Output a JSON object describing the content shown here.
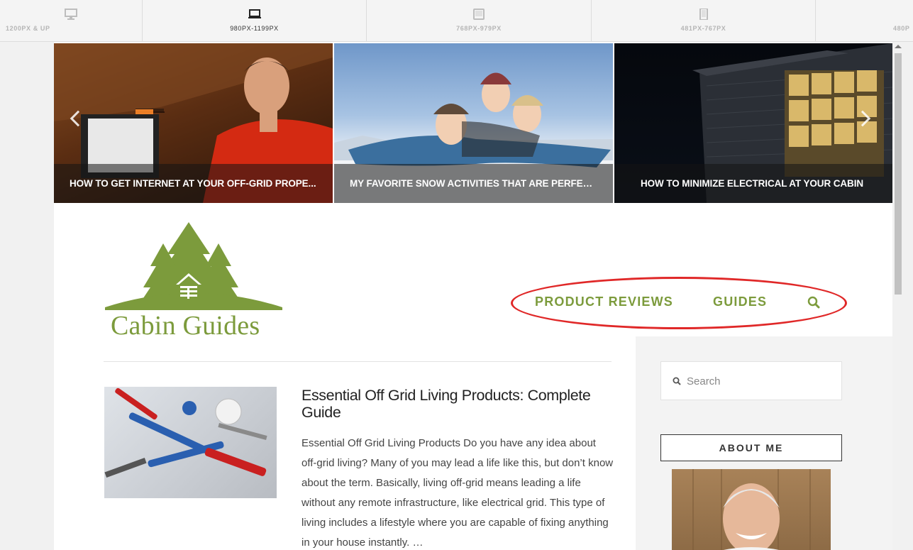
{
  "responsive_bar": {
    "tabs": [
      {
        "label": "1200PX & UP",
        "icon": "desktop-icon"
      },
      {
        "label": "980PX-1199PX",
        "icon": "laptop-icon"
      },
      {
        "label": "768PX-979PX",
        "icon": "tablet-landscape-icon"
      },
      {
        "label": "481PX-767PX",
        "icon": "tablet-portrait-icon"
      },
      {
        "label": "480P",
        "icon": "phone-icon"
      }
    ],
    "active_index": 1
  },
  "slider": {
    "slides": [
      {
        "caption": "HOW TO GET INTERNET AT YOUR OFF-GRID PROPE..."
      },
      {
        "caption": "MY FAVORITE SNOW ACTIVITIES THAT ARE PERFEC..."
      },
      {
        "caption": "HOW TO MINIMIZE ELECTRICAL AT YOUR CABIN"
      }
    ]
  },
  "header": {
    "logo_text": "Cabin Guides",
    "brand_color": "#7c9b3c",
    "nav": {
      "product_reviews": "PRODUCT REVIEWS",
      "guides": "GUIDES"
    },
    "annotation_color": "#e02828"
  },
  "post": {
    "title": "Essential Off Grid Living Products: Complete Guide",
    "excerpt": "Essential Off Grid Living Products Do you have any idea about off-grid living? Many of you may lead a life like this, but don’t know about the term. Basically, living off-grid means leading a life without any remote infrastructure, like electrical grid. This type of living includes a lifestyle where you are capable of fixing anything in your house instantly. …"
  },
  "sidebar": {
    "search_placeholder": "Search",
    "about_title": "ABOUT ME"
  }
}
